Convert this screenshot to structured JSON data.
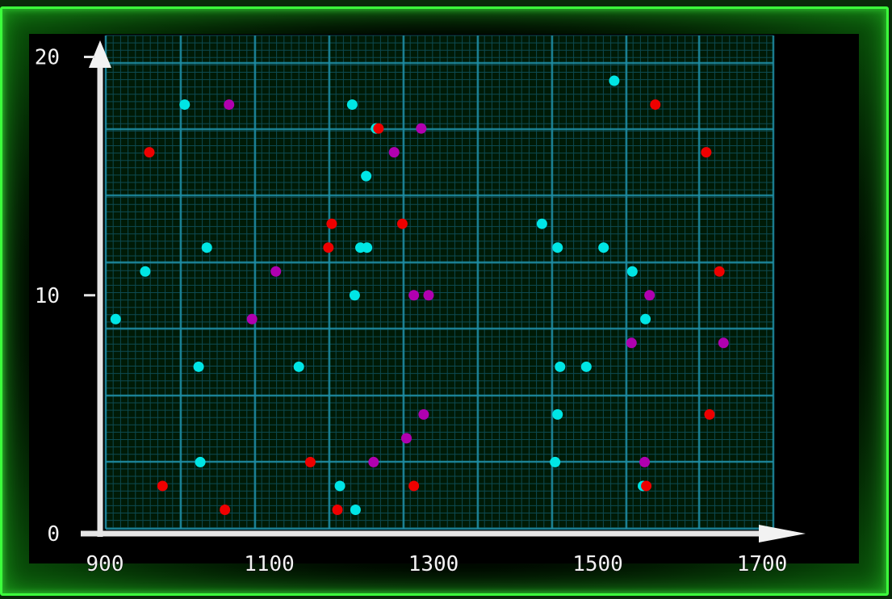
{
  "chart_data": {
    "type": "scatter",
    "title": "",
    "xlabel": "",
    "ylabel": "",
    "xlim": [
      900,
      1700
    ],
    "ylim": [
      0,
      21
    ],
    "x_ticks": [
      "900",
      "1100",
      "1300",
      "1500",
      "1700"
    ],
    "y_ticks": [
      "0",
      "10",
      "20"
    ],
    "grid": true,
    "colors": {
      "background": "#000000",
      "grid_major": "#1f8fa6",
      "grid_minor": "#0d4a52",
      "axis": "#e6e6e6",
      "frame": "#3cff3c"
    },
    "series": [
      {
        "color": "#00e5e5",
        "points": [
          [
            1001,
            18
          ],
          [
            1205,
            18
          ],
          [
            1524,
            19
          ],
          [
            1234,
            17
          ],
          [
            1222,
            15
          ],
          [
            1436,
            13
          ],
          [
            1028,
            12
          ],
          [
            1215,
            12
          ],
          [
            1223,
            12
          ],
          [
            1455,
            12
          ],
          [
            1511,
            12
          ],
          [
            953,
            11
          ],
          [
            1546,
            11
          ],
          [
            1208,
            10
          ],
          [
            917,
            9
          ],
          [
            1562,
            9
          ],
          [
            1018,
            7
          ],
          [
            1140,
            7
          ],
          [
            1458,
            7
          ],
          [
            1490,
            7
          ],
          [
            1455,
            5
          ],
          [
            1020,
            3
          ],
          [
            1452,
            3
          ],
          [
            1190,
            2
          ],
          [
            1559,
            2
          ],
          [
            1209,
            1
          ]
        ]
      },
      {
        "color": "#ee0000",
        "points": [
          [
            1574,
            18
          ],
          [
            958,
            16
          ],
          [
            1636,
            16
          ],
          [
            1237,
            17
          ],
          [
            1180,
            13
          ],
          [
            1266,
            13
          ],
          [
            1176,
            12
          ],
          [
            1652,
            11
          ],
          [
            1640,
            5
          ],
          [
            1154,
            3
          ],
          [
            974,
            2
          ],
          [
            1280,
            2
          ],
          [
            1563,
            2
          ],
          [
            1050,
            1
          ],
          [
            1187,
            1
          ]
        ]
      },
      {
        "color": "#b000b0",
        "points": [
          [
            1055,
            18
          ],
          [
            1289,
            17
          ],
          [
            1256,
            16
          ],
          [
            1112,
            11
          ],
          [
            1280,
            10
          ],
          [
            1298,
            10
          ],
          [
            1567,
            10
          ],
          [
            1083,
            9
          ],
          [
            1545,
            8
          ],
          [
            1657,
            8
          ],
          [
            1292,
            5
          ],
          [
            1271,
            4
          ],
          [
            1231,
            3
          ],
          [
            1561,
            3
          ]
        ]
      }
    ]
  }
}
